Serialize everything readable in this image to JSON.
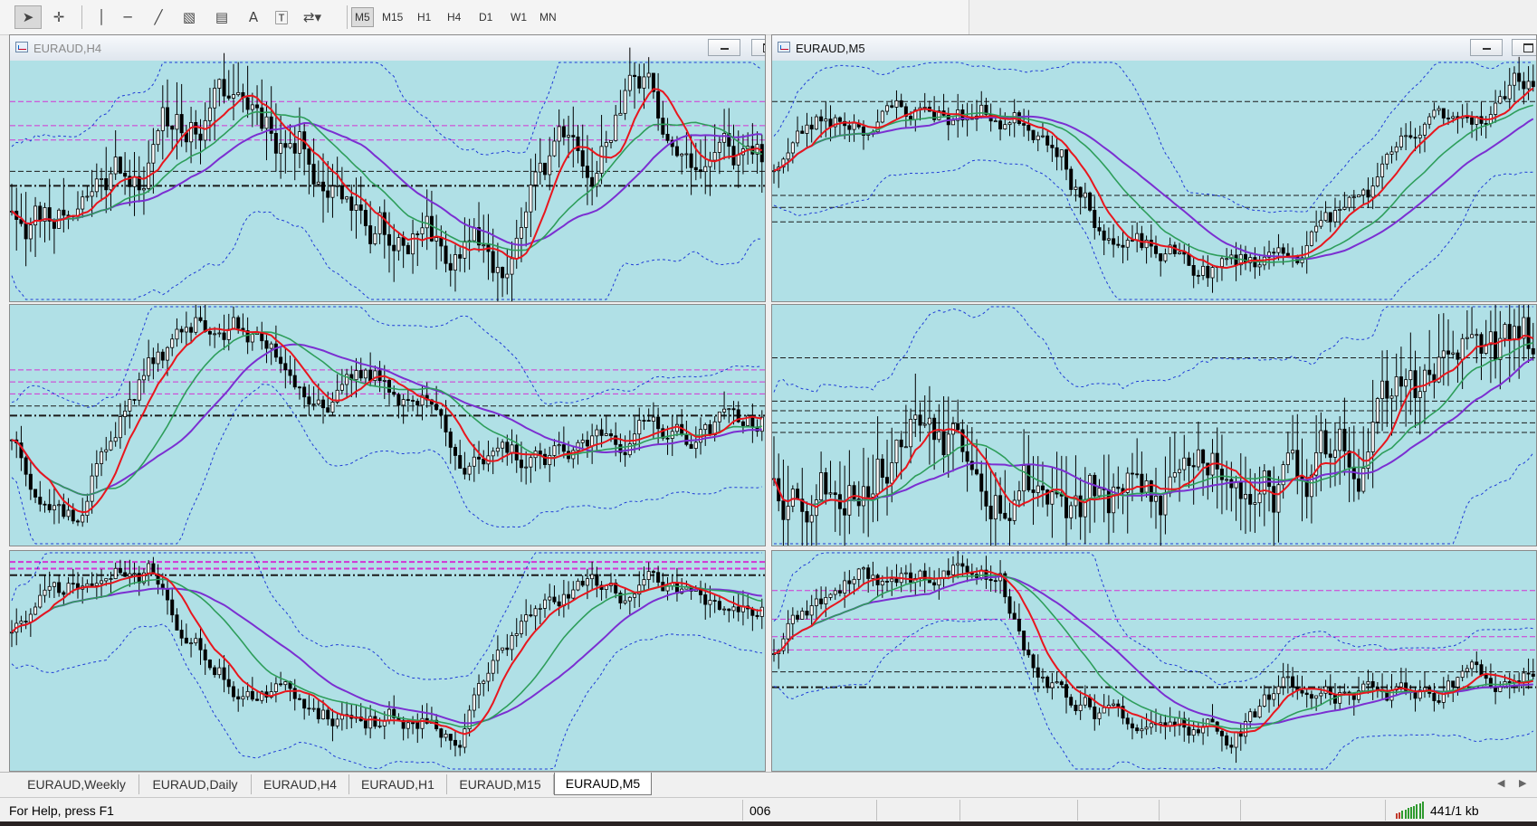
{
  "toolbar": {
    "tools": [
      {
        "icon": "cursor-icon",
        "glyph": "➤",
        "active": true
      },
      {
        "icon": "crosshair-icon",
        "glyph": "✛",
        "active": false
      },
      {
        "icon": "vertical-line-icon",
        "glyph": "│",
        "active": false
      },
      {
        "icon": "horizontal-line-icon",
        "glyph": "─",
        "active": false
      },
      {
        "icon": "trendline-icon",
        "glyph": "╱",
        "active": false
      },
      {
        "icon": "equidistant-channel-icon",
        "glyph": "▧",
        "active": false
      },
      {
        "icon": "fibonacci-icon",
        "glyph": "▤",
        "active": false
      },
      {
        "icon": "text-icon",
        "glyph": "A",
        "active": false
      },
      {
        "icon": "text-label-icon",
        "glyph": "🅃",
        "active": false
      },
      {
        "icon": "arrows-dropdown-icon",
        "glyph": "⇄▾",
        "active": false
      }
    ],
    "timeframes": [
      "M5",
      "M15",
      "H1",
      "H4",
      "D1",
      "W1",
      "MN"
    ],
    "active_timeframe": "M5"
  },
  "windows": {
    "top_left": {
      "title": "EURAUD,H4"
    },
    "top_right": {
      "title": "EURAUD,M5"
    }
  },
  "colors": {
    "chart_bg": "#b0e0e6",
    "candle": "#000000",
    "ma_fast": "#e8161d",
    "ma_mid": "#2e9e5b",
    "ma_slow": "#7b2fd1",
    "bollinger": "#1f3cd6",
    "level_magenta": "#d333d3",
    "level_black": "#1a1a1a"
  },
  "tabs": [
    "EURAUD,Weekly",
    "EURAUD,Daily",
    "EURAUD,H4",
    "EURAUD,H1",
    "EURAUD,M15",
    "EURAUD,M5"
  ],
  "active_tab": "EURAUD,M5",
  "status": {
    "help": "For Help, press F1",
    "profile": "006",
    "traffic": "441/1 kb"
  }
}
